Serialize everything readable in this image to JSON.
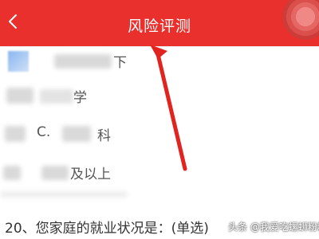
{
  "header": {
    "title": "风险评测",
    "back_icon": "back-arrow-icon",
    "background_color": "#e9302c"
  },
  "options": [
    {
      "label": "",
      "prefix": "",
      "suffix": "下"
    },
    {
      "label": "",
      "prefix": "",
      "suffix": "学"
    },
    {
      "label": "C.",
      "prefix": "C.",
      "suffix": "科"
    },
    {
      "label": "",
      "prefix": "",
      "suffix": "及以上"
    }
  ],
  "question": {
    "text": "20、您家庭的就业状况是：(单选)"
  },
  "watermark": {
    "text": "头条 @我爱吃螺蛳粉粉"
  },
  "annotation": {
    "type": "red-arrow",
    "color": "#e1241f"
  }
}
